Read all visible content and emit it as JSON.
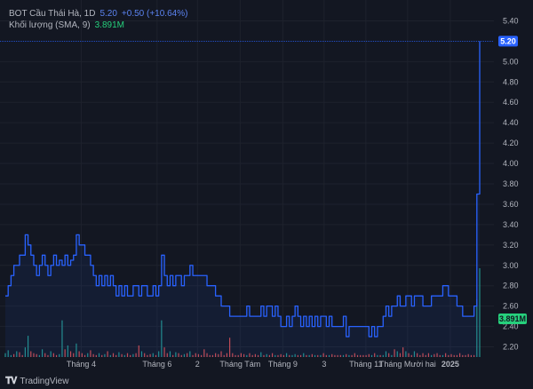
{
  "legend": {
    "symbol": "BOT Cầu Thái Hà, 1D",
    "price": "5.20",
    "change": "+0.50 (+10.64%)",
    "volume_label": "Khối lượng (SMA, 9)",
    "volume_value": "3.891M"
  },
  "footer": {
    "brand": "TradingView"
  },
  "colors": {
    "background": "#131722",
    "line": "#2962ff",
    "up_volume": "#26a69a",
    "down_volume": "#ef5350",
    "price_badge": "#2962ff",
    "volume_badge": "#26d07c"
  },
  "chart_data": {
    "type": "line",
    "title": "",
    "xlabel": "",
    "ylabel": "",
    "ylim": [
      2.1,
      5.5
    ],
    "y_ticks": [
      "5.40",
      "5.00",
      "4.80",
      "4.60",
      "4.40",
      "4.20",
      "4.00",
      "3.80",
      "3.60",
      "3.40",
      "3.20",
      "3.00",
      "2.80",
      "2.60",
      "2.40",
      "2.20"
    ],
    "x_ticks": [
      "Tháng 4",
      "Tháng 6",
      "2",
      "Tháng Tám",
      "Tháng 9",
      "3",
      "Tháng 11",
      "Tháng Mười hai",
      "2025"
    ],
    "last_price_label": "5.20",
    "volume_label": "3.891M",
    "series": [
      {
        "values": [
          2.7,
          2.8,
          2.9,
          3.0,
          3.0,
          3.1,
          3.1,
          3.3,
          3.2,
          3.1,
          3.0,
          2.9,
          3.0,
          3.1,
          3.0,
          2.9,
          3.0,
          3.1,
          3.0,
          3.05,
          3.0,
          3.1,
          3.0,
          3.05,
          3.1,
          3.3,
          3.2,
          3.2,
          3.1,
          3.1,
          3.0,
          2.9,
          2.8,
          2.9,
          2.8,
          2.9,
          2.8,
          2.9,
          2.8,
          2.7,
          2.8,
          2.7,
          2.8,
          2.7,
          2.7,
          2.8,
          2.8,
          2.7,
          2.8,
          2.8,
          2.7,
          2.7,
          2.8,
          2.7,
          2.8,
          3.1,
          2.9,
          2.8,
          2.9,
          2.8,
          2.9,
          2.9,
          2.8,
          2.9,
          2.9,
          3.0,
          2.9,
          2.9,
          2.9,
          2.9,
          2.9,
          2.8,
          2.8,
          2.8,
          2.7,
          2.7,
          2.6,
          2.6,
          2.6,
          2.5,
          2.5,
          2.5,
          2.5,
          2.5,
          2.5,
          2.6,
          2.5,
          2.5,
          2.5,
          2.5,
          2.6,
          2.5,
          2.6,
          2.6,
          2.5,
          2.6,
          2.5,
          2.4,
          2.4,
          2.5,
          2.4,
          2.5,
          2.6,
          2.5,
          2.4,
          2.5,
          2.4,
          2.5,
          2.4,
          2.5,
          2.4,
          2.5,
          2.5,
          2.4,
          2.5,
          2.4,
          2.4,
          2.4,
          2.4,
          2.5,
          2.3,
          2.4,
          2.4,
          2.4,
          2.4,
          2.4,
          2.4,
          2.4,
          2.3,
          2.4,
          2.3,
          2.4,
          2.4,
          2.5,
          2.6,
          2.5,
          2.6,
          2.6,
          2.7,
          2.6,
          2.6,
          2.7,
          2.7,
          2.6,
          2.7,
          2.7,
          2.7,
          2.6,
          2.6,
          2.6,
          2.7,
          2.7,
          2.7,
          2.7,
          2.8,
          2.8,
          2.7,
          2.7,
          2.7,
          2.6,
          2.6,
          2.5,
          2.5,
          2.5,
          2.5,
          2.6,
          3.7,
          5.2
        ]
      }
    ],
    "volume": [
      0.2,
      0.35,
      0.1,
      0.15,
      0.3,
      0.25,
      0.1,
      0.5,
      1.1,
      0.3,
      0.2,
      0.15,
      0.1,
      0.4,
      0.2,
      0.1,
      0.3,
      0.2,
      0.1,
      0.15,
      1.9,
      0.4,
      0.6,
      0.3,
      0.2,
      0.7,
      0.3,
      0.2,
      0.1,
      0.2,
      0.35,
      0.15,
      0.1,
      0.2,
      0.1,
      0.15,
      0.3,
      0.1,
      0.2,
      0.1,
      0.25,
      0.15,
      0.1,
      0.2,
      0.1,
      0.15,
      0.2,
      0.6,
      0.3,
      0.2,
      0.1,
      0.15,
      0.2,
      0.1,
      0.3,
      1.9,
      0.5,
      0.2,
      0.3,
      0.1,
      0.25,
      0.2,
      0.1,
      0.15,
      0.2,
      0.3,
      0.1,
      0.2,
      0.15,
      0.1,
      0.4,
      0.2,
      0.1,
      0.1,
      0.2,
      0.15,
      0.3,
      0.1,
      0.2,
      1.0,
      0.2,
      0.1,
      0.1,
      0.2,
      0.15,
      0.1,
      0.2,
      0.1,
      0.15,
      0.1,
      0.25,
      0.1,
      0.15,
      0.1,
      0.2,
      0.1,
      0.1,
      0.15,
      0.1,
      0.2,
      0.1,
      0.1,
      0.15,
      0.1,
      0.1,
      0.2,
      0.1,
      0.1,
      0.15,
      0.1,
      0.1,
      0.1,
      0.2,
      0.1,
      0.1,
      0.15,
      0.1,
      0.1,
      0.1,
      0.1,
      0.15,
      0.1,
      0.1,
      0.2,
      0.1,
      0.1,
      0.1,
      0.1,
      0.15,
      0.1,
      0.2,
      0.1,
      0.1,
      0.1,
      0.3,
      0.2,
      0.1,
      0.4,
      0.3,
      0.2,
      0.5,
      0.3,
      0.2,
      0.1,
      0.3,
      0.2,
      0.1,
      0.2,
      0.1,
      0.2,
      0.1,
      0.15,
      0.2,
      0.1,
      0.1,
      0.2,
      0.1,
      0.15,
      0.1,
      0.1,
      0.2,
      0.1,
      0.1,
      0.15,
      0.1,
      0.1,
      3.0,
      4.6
    ],
    "volume_direction": [
      1,
      1,
      1,
      0,
      1,
      0,
      0,
      1,
      1,
      0,
      0,
      0,
      1,
      1,
      0,
      0,
      1,
      0,
      0,
      1,
      1,
      0,
      1,
      0,
      0,
      1,
      0,
      0,
      0,
      1,
      0,
      0,
      0,
      1,
      0,
      1,
      0,
      1,
      0,
      0,
      1,
      0,
      1,
      0,
      0,
      1,
      0,
      0,
      1,
      0,
      0,
      0,
      1,
      0,
      1,
      1,
      0,
      0,
      1,
      0,
      1,
      0,
      0,
      1,
      0,
      1,
      0,
      0,
      0,
      0,
      0,
      0,
      0,
      0,
      0,
      0,
      0,
      0,
      0,
      0,
      0,
      0,
      0,
      0,
      0,
      1,
      0,
      0,
      0,
      0,
      1,
      0,
      1,
      0,
      0,
      1,
      0,
      0,
      0,
      1,
      0,
      1,
      1,
      0,
      0,
      1,
      0,
      1,
      0,
      1,
      0,
      1,
      0,
      0,
      1,
      0,
      0,
      0,
      0,
      1,
      0,
      1,
      0,
      0,
      0,
      0,
      0,
      0,
      0,
      1,
      0,
      1,
      0,
      1,
      1,
      0,
      1,
      0,
      1,
      0,
      0,
      1,
      0,
      0,
      1,
      0,
      0,
      0,
      0,
      0,
      1,
      0,
      0,
      0,
      1,
      0,
      0,
      0,
      0,
      0,
      0,
      0,
      0,
      0,
      0,
      0,
      1,
      1,
      1
    ]
  }
}
